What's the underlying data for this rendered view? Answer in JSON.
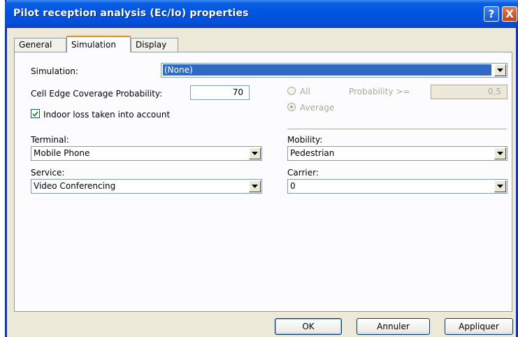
{
  "window": {
    "title": "Pilot reception analysis (Ec/Io) properties",
    "help_glyph": "?",
    "close_glyph": "X"
  },
  "tabs": [
    {
      "label": "General",
      "active": false
    },
    {
      "label": "Simulation",
      "active": true
    },
    {
      "label": "Display",
      "active": false
    }
  ],
  "simulation": {
    "label": "Simulation:",
    "value": "(None)"
  },
  "cell_edge": {
    "label": "Cell Edge Coverage Probability:",
    "value": "70"
  },
  "indoor_loss": {
    "label": "Indoor loss taken into account",
    "checked": true
  },
  "options": {
    "all_label": "All",
    "average_label": "Average",
    "selected": "Average",
    "probability_label": "Probability >=",
    "probability_value": "0,5"
  },
  "terminal": {
    "label": "Terminal:",
    "value": "Mobile Phone"
  },
  "mobility": {
    "label": "Mobility:",
    "value": "Pedestrian"
  },
  "service": {
    "label": "Service:",
    "value": "Video Conferencing"
  },
  "carrier": {
    "label": "Carrier:",
    "value": "0"
  },
  "buttons": {
    "ok": "OK",
    "cancel": "Annuler",
    "apply": "Appliquer"
  },
  "colors": {
    "title_bar": "#0054e3",
    "selection": "#316ac5",
    "dialog_bg": "#ece9d8"
  }
}
